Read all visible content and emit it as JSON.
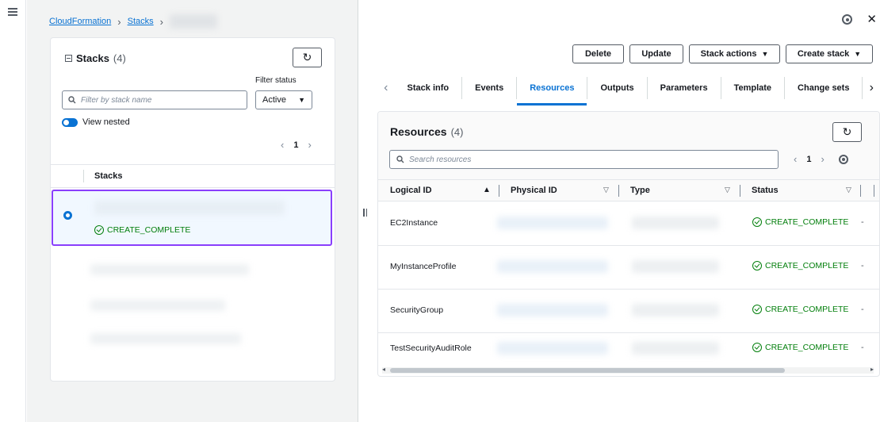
{
  "breadcrumb": {
    "root": "CloudFormation",
    "stacks": "Stacks"
  },
  "stacks_panel": {
    "title": "Stacks",
    "count": "(4)",
    "filter_label": "Filter status",
    "search_placeholder": "Filter by stack name",
    "filter_value": "Active",
    "view_nested": "View nested",
    "page": "1",
    "column_header": "Stacks",
    "selected_status": "CREATE_COMPLETE"
  },
  "actions": {
    "delete": "Delete",
    "update": "Update",
    "stack_actions": "Stack actions",
    "create_stack": "Create stack"
  },
  "tabs": [
    {
      "label": "Stack info"
    },
    {
      "label": "Events"
    },
    {
      "label": "Resources"
    },
    {
      "label": "Outputs"
    },
    {
      "label": "Parameters"
    },
    {
      "label": "Template"
    },
    {
      "label": "Change sets"
    }
  ],
  "resources": {
    "title": "Resources",
    "count": "(4)",
    "search_placeholder": "Search resources",
    "page": "1",
    "columns": {
      "logical_id": "Logical ID",
      "physical_id": "Physical ID",
      "type": "Type",
      "status": "Status"
    },
    "rows": [
      {
        "logical_id": "EC2Instance",
        "status": "CREATE_COMPLETE",
        "extra": "-"
      },
      {
        "logical_id": "MyInstanceProfile",
        "status": "CREATE_COMPLETE",
        "extra": "-"
      },
      {
        "logical_id": "SecurityGroup",
        "status": "CREATE_COMPLETE",
        "extra": "-"
      },
      {
        "logical_id": "TestSecurityAuditRole",
        "status": "CREATE_COMPLETE",
        "extra": "-"
      }
    ]
  },
  "colors": {
    "accent": "#0972d3",
    "success": "#037f0c",
    "selection": "#8a3ffc"
  }
}
